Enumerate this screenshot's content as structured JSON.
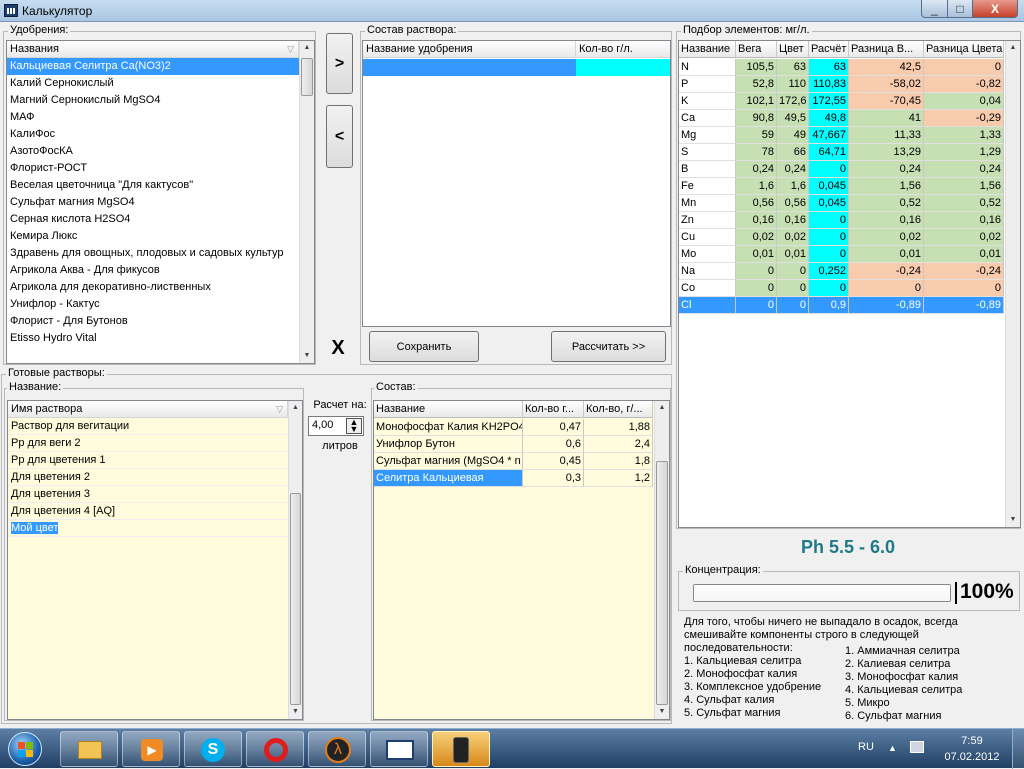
{
  "window": {
    "title": "Калькулятор",
    "min": "_",
    "max": "□",
    "close": "X"
  },
  "fertilizers": {
    "group_label": "Удобрения:",
    "column": "Названия",
    "items": [
      "Кальциевая Селитра Ca(NO3)2",
      "Калий Сернокислый",
      "Магний Сернокислый MgSO4",
      "МАФ",
      "КалиФос",
      "АзотоФосКА",
      "Флорист-РОСТ",
      "Веселая цветочница \"Для кактусов\"",
      "Сульфат магния MgSO4",
      "Серная кислота H2SO4",
      "Кемира Люкс",
      "Здравень для овощных, плодовых и садовых культур",
      "Агрикола Аква - Для фикусов",
      "Агрикола для декоративно-лиственных",
      "Унифлор - Кактус",
      "Флорист - Для Бутонов",
      "Etisso Hydro Vital"
    ],
    "selected_index": 0
  },
  "transfer": {
    "add": ">",
    "remove": "<",
    "clear": "X"
  },
  "solution": {
    "group_label": "Состав раствора:",
    "col_name": "Название удобрения",
    "col_amount": "Кол-во г/л.",
    "save_button": "Сохранить",
    "calc_button": "Рассчитать >>"
  },
  "elements": {
    "group_label": "Подбор элементов: мг/л.",
    "headers": [
      "Название",
      "Вега",
      "Цвет",
      "Расчёт",
      "Разница В...",
      "Разница Цвета"
    ],
    "rows": [
      [
        "N",
        "105,5",
        "63",
        "63",
        "42,5",
        "0"
      ],
      [
        "P",
        "52,8",
        "110",
        "110,83",
        "-58,02",
        "-0,82"
      ],
      [
        "K",
        "102,1",
        "172,6",
        "172,55",
        "-70,45",
        "0,04"
      ],
      [
        "Ca",
        "90,8",
        "49,5",
        "49,8",
        "41",
        "-0,29"
      ],
      [
        "Mg",
        "59",
        "49",
        "47,667",
        "11,33",
        "1,33"
      ],
      [
        "S",
        "78",
        "66",
        "64,71",
        "13,29",
        "1,29"
      ],
      [
        "B",
        "0,24",
        "0,24",
        "0",
        "0,24",
        "0,24"
      ],
      [
        "Fe",
        "1,6",
        "1,6",
        "0,045",
        "1,56",
        "1,56"
      ],
      [
        "Mn",
        "0,56",
        "0,56",
        "0,045",
        "0,52",
        "0,52"
      ],
      [
        "Zn",
        "0,16",
        "0,16",
        "0",
        "0,16",
        "0,16"
      ],
      [
        "Cu",
        "0,02",
        "0,02",
        "0",
        "0,02",
        "0,02"
      ],
      [
        "Mo",
        "0,01",
        "0,01",
        "0",
        "0,01",
        "0,01"
      ],
      [
        "Na",
        "0",
        "0",
        "0,252",
        "-0,24",
        "-0,24"
      ],
      [
        "Co",
        "0",
        "0",
        "0",
        "0",
        "0"
      ],
      [
        "Cl",
        "0",
        "0",
        "0,9",
        "-0,89",
        "-0,89"
      ]
    ],
    "selected_index": 14,
    "ph": "Ph 5.5 - 6.0"
  },
  "concentration": {
    "group_label": "Концентрация:",
    "value": "100%",
    "level": 1.0
  },
  "ready": {
    "group_label": "Готовые растворы:",
    "sub_label": "Название:",
    "column": "Имя раствора",
    "items": [
      "Раствор для вегитации",
      "Рр для веги 2",
      "Рр для цветения 1",
      "Для цветения 2",
      "Для цветения 3",
      "Для цветения 4 [AQ]",
      "Мой цвет"
    ],
    "selected_index": 6,
    "calc_for_label": "Расчет на:",
    "liters_value": "4,00",
    "liters_label": "литров"
  },
  "composition": {
    "group_label": "Состав:",
    "headers": [
      "Название",
      "Кол-во г...",
      "Кол-во, г/..."
    ],
    "rows": [
      [
        "Монофосфат Калия KH2PO4",
        "0,47",
        "1,88"
      ],
      [
        "Унифлор Бутон",
        "0,6",
        "2,4"
      ],
      [
        "Сульфат магния (MgSO4 * n",
        "0,45",
        "1,8"
      ],
      [
        "Селитра Кальциевая",
        "0,3",
        "1,2"
      ]
    ],
    "selected_index": 3
  },
  "hint": {
    "intro": [
      "Для того, чтобы ничего не выпадало в осадок, всегда",
      "смешивайте компоненты строго в следующей",
      "последовательности:"
    ],
    "left": [
      "1. Кальциевая селитра",
      "2. Монофосфат калия",
      "3. Комплексное удобрение",
      "4. Сульфат калия",
      "5. Сульфат магния"
    ],
    "right": [
      "1. Аммиачная селитра",
      "2. Калиевая селитра",
      "3. Монофосфат калия",
      "4. Кальциевая селитра",
      "5. Микро",
      "6. Сульфат магния"
    ]
  },
  "taskbar": {
    "apps": [
      "explorer-icon",
      "media-player-icon",
      "skype-icon",
      "opera-icon",
      "half-life-icon",
      "calculator-app-icon",
      "phone-app-icon"
    ],
    "lang": "RU",
    "time": "7:59",
    "date": "07.02.2012"
  }
}
